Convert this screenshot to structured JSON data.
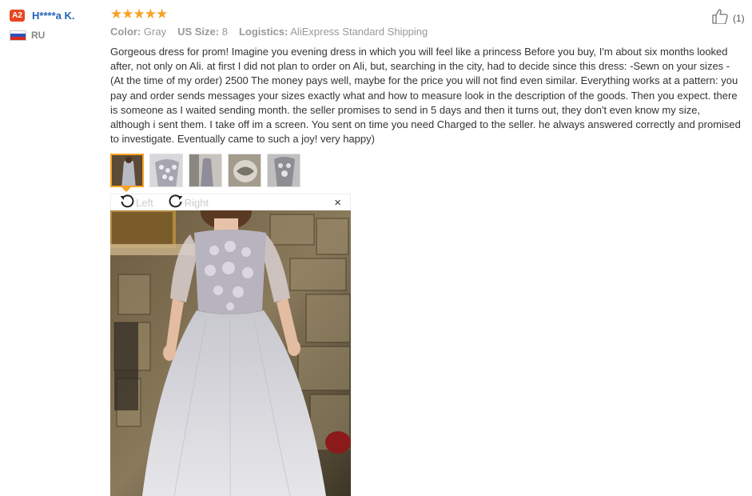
{
  "user": {
    "level": "A2",
    "name": "H****a K.",
    "country": "RU"
  },
  "rating": {
    "stars": 5,
    "max": 5
  },
  "helpful": {
    "count": "(1)"
  },
  "attributes": [
    {
      "key": "Color:",
      "value": "Gray"
    },
    {
      "key": "US Size:",
      "value": "8"
    },
    {
      "key": "Logistics:",
      "value": "AliExpress Standard Shipping"
    }
  ],
  "review_text": "Gorgeous dress for prom! Imagine you evening dress in which you will feel like a princess Before you buy, I'm about six months looked after, not only on Ali. at first I did not plan to order on Ali, but, searching in the city, had to decide since this dress: -Sewn on your sizes -(At the time of my order) 2500 The money pays well, maybe for the price you will not find even similar. Everything works at a pattern: you pay and order sends messages your sizes exactly what and how to measure look in the description of the goods. Then you expect. there is someone as I waited sending month. the seller promises to send in 5 days and then it turns out, they don't even know my size, although i sent them. I take off im a screen. You sent on time you need Charged to the seller. he always answered correctly and promised to investigate. Eventually came to such a joy! very happy)",
  "viewer": {
    "rotate_left_label": "Left",
    "rotate_right_label": "Right",
    "close_label": "×"
  },
  "colors": {
    "accent": "#f6a224",
    "badge": "#e9461f",
    "username": "#2463b5"
  },
  "thumbnails": [
    {
      "name": "dress-photo-1",
      "active": true
    },
    {
      "name": "dress-photo-2",
      "active": false
    },
    {
      "name": "dress-photo-3",
      "active": false
    },
    {
      "name": "dress-photo-4",
      "active": false
    },
    {
      "name": "dress-photo-5",
      "active": false
    }
  ]
}
